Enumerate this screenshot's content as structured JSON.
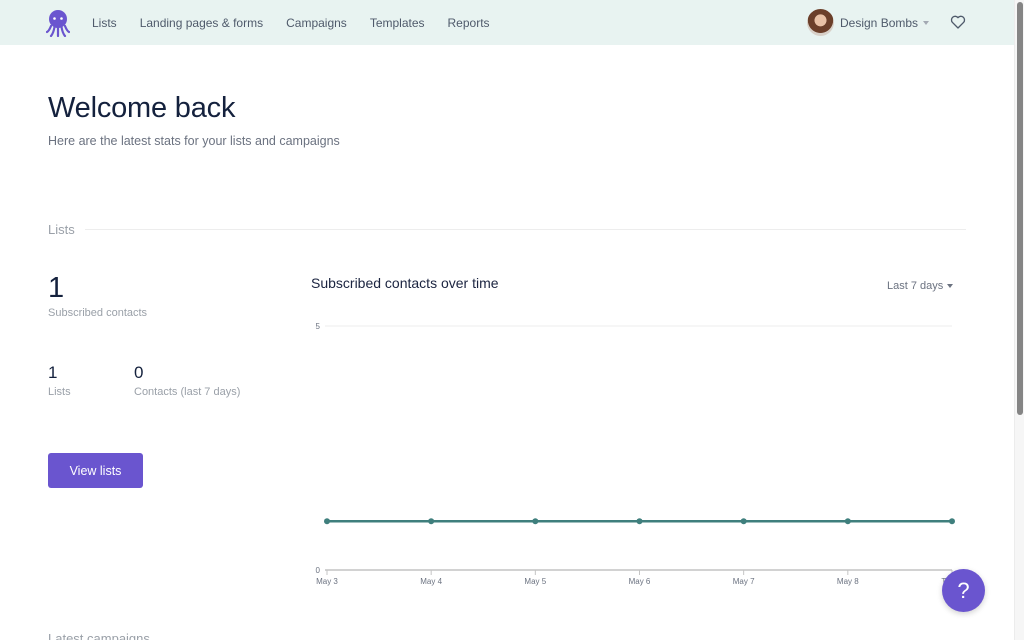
{
  "nav": {
    "logo_icon": "octopus-logo-icon",
    "items": [
      {
        "label": "Lists"
      },
      {
        "label": "Landing pages & forms"
      },
      {
        "label": "Campaigns"
      },
      {
        "label": "Templates"
      },
      {
        "label": "Reports"
      }
    ],
    "user_name": "Design Bombs",
    "favorites_icon": "heart-icon"
  },
  "header": {
    "title": "Welcome back",
    "subtitle": "Here are the latest stats for your lists and campaigns"
  },
  "lists_section": {
    "label": "Lists",
    "subscribed_contacts": {
      "value": "1",
      "label": "Subscribed contacts"
    },
    "lists": {
      "value": "1",
      "label": "Lists"
    },
    "recent_contacts": {
      "value": "0",
      "label": "Contacts (last 7 days)"
    },
    "view_button": "View lists"
  },
  "chart_panel": {
    "title": "Subscribed contacts over time",
    "range_selected": "Last 7 days"
  },
  "chart_data": {
    "type": "line",
    "title": "Subscribed contacts over time",
    "xlabel": "",
    "ylabel": "",
    "x": [
      "May 3",
      "May 4",
      "May 5",
      "May 6",
      "May 7",
      "May 8",
      "Today"
    ],
    "series": [
      {
        "name": "Subscribed contacts",
        "values": [
          1,
          1,
          1,
          1,
          1,
          1,
          1
        ],
        "color": "#3f7f7d"
      }
    ],
    "ylim": [
      0,
      5
    ],
    "yticks": [
      0,
      5
    ],
    "grid": true,
    "legend": "none"
  },
  "help_button": "?",
  "next_section_label": "Latest campaigns",
  "colors": {
    "brand": "#6a55cf",
    "topbar_bg": "#e8f3f1",
    "line": "#3f7f7d"
  },
  "scroll": {
    "position_fraction": 0.0,
    "visible_fraction": 0.65
  }
}
